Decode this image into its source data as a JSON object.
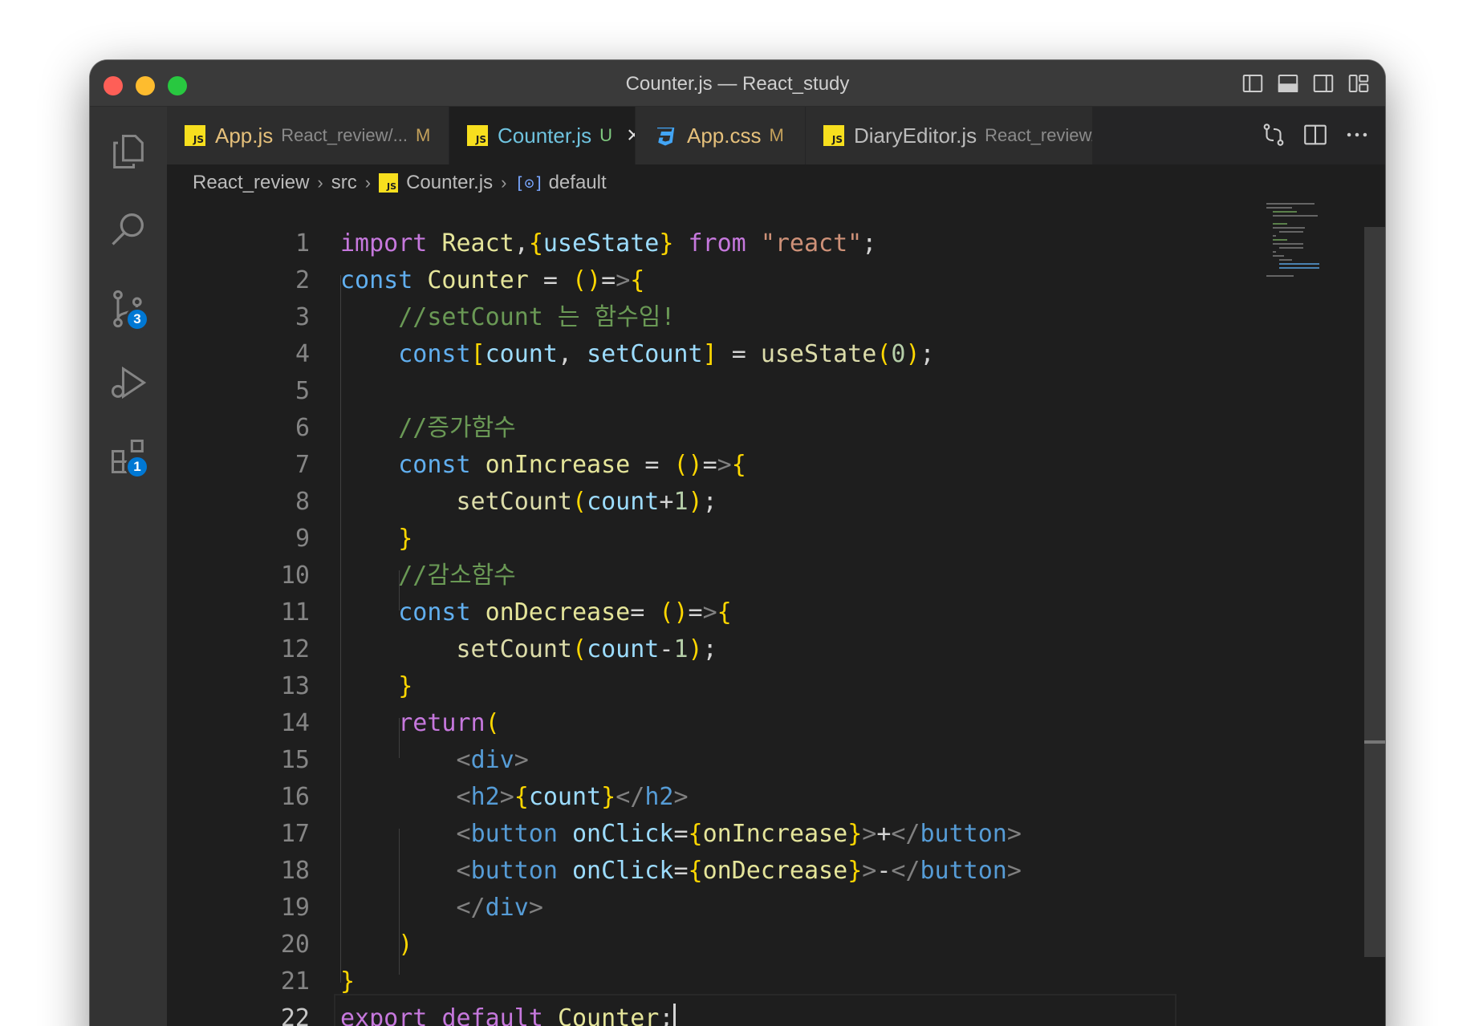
{
  "window": {
    "title": "Counter.js — React_study"
  },
  "activity": {
    "source_control_badge": "3",
    "extensions_badge": "1"
  },
  "tabs": [
    {
      "name": "App.js",
      "path": "React_review/...",
      "status": "M"
    },
    {
      "name": "Counter.js",
      "status": "U",
      "close": "×"
    },
    {
      "name": "App.css",
      "status": "M"
    },
    {
      "name": "DiaryEditor.js",
      "path": "React_review/.."
    }
  ],
  "breadcrumb": {
    "items": [
      "React_review",
      "src",
      "Counter.js",
      "default"
    ]
  },
  "editor": {
    "line_numbers": [
      "1",
      "2",
      "3",
      "4",
      "5",
      "6",
      "7",
      "8",
      "9",
      "10",
      "11",
      "12",
      "13",
      "14",
      "15",
      "16",
      "17",
      "18",
      "19",
      "20",
      "21",
      "22"
    ],
    "current_line": "22",
    "code_lines": [
      "import React,{useState} from \"react\";",
      "const Counter = ()=>{",
      "    //setCount 는 함수임!",
      "    const[count, setCount] = useState(0);",
      "",
      "    //증가함수",
      "    const onIncrease = ()=>{",
      "        setCount(count+1);",
      "    }",
      "    //감소함수",
      "    const onDecrease= ()=>{",
      "        setCount(count-1);",
      "    }",
      "    return(",
      "        <div>",
      "        <h2>{count}</h2>",
      "        <button onClick={onIncrease}>+</button>",
      "        <button onClick={onDecrease}>-</button>",
      "        </div>",
      "    )",
      "}",
      "export default Counter;"
    ]
  },
  "colors": {
    "editor_bg": "#1e1e1e",
    "titlebar_bg": "#3a3a3a",
    "activity_bg": "#333333",
    "badge": "#0078d4",
    "js_icon": "#f7df1e"
  }
}
